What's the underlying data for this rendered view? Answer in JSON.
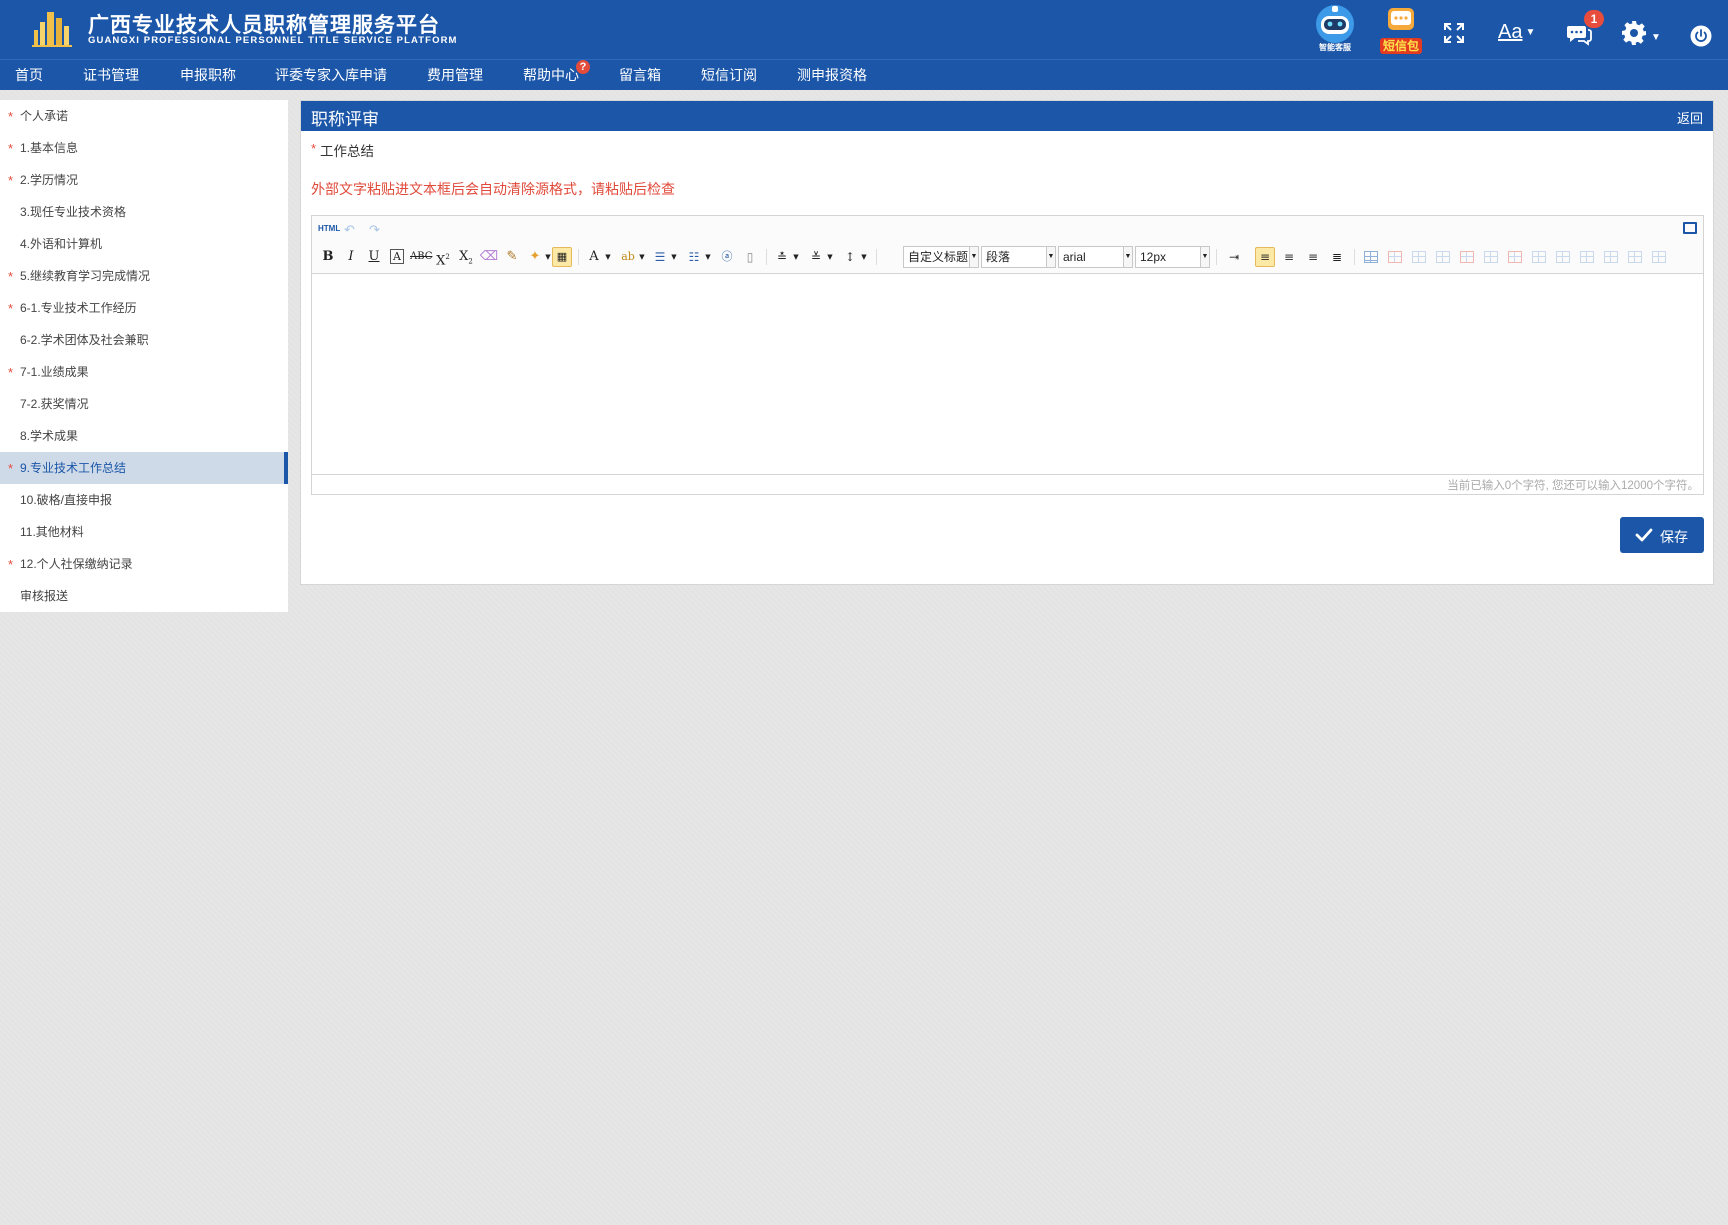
{
  "header": {
    "title_cn": "广西专业技术人员职称管理服务平台",
    "title_en": "GUANGXI PROFESSIONAL  PERSONNEL  TITLE SERVICE PLATFORM",
    "robot_caption": "智能客服",
    "sms_caption": "短信包",
    "font_label": "Aa",
    "notification_count": "1",
    "brand_color": "#1b56a8"
  },
  "nav": {
    "items": [
      {
        "label": "首页"
      },
      {
        "label": "证书管理"
      },
      {
        "label": "申报职称"
      },
      {
        "label": "评委专家入库申请"
      },
      {
        "label": "费用管理"
      },
      {
        "label": "帮助中心"
      },
      {
        "label": "留言箱"
      },
      {
        "label": "短信订阅"
      },
      {
        "label": "测申报资格"
      }
    ],
    "help_badge": "?"
  },
  "sidebar": {
    "items": [
      {
        "label": "个人承诺",
        "required": true
      },
      {
        "label": "1.基本信息",
        "required": true
      },
      {
        "label": "2.学历情况",
        "required": true
      },
      {
        "label": "3.现任专业技术资格",
        "required": false
      },
      {
        "label": "4.外语和计算机",
        "required": false
      },
      {
        "label": "5.继续教育学习完成情况",
        "required": true
      },
      {
        "label": "6-1.专业技术工作经历",
        "required": true
      },
      {
        "label": "6-2.学术团体及社会兼职",
        "required": false
      },
      {
        "label": "7-1.业绩成果",
        "required": true
      },
      {
        "label": "7-2.获奖情况",
        "required": false
      },
      {
        "label": "8.学术成果",
        "required": false
      },
      {
        "label": "9.专业技术工作总结",
        "required": true,
        "active": true
      },
      {
        "label": "10.破格/直接申报",
        "required": false
      },
      {
        "label": "11.其他材料",
        "required": false
      },
      {
        "label": "12.个人社保缴纳记录",
        "required": true
      },
      {
        "label": "审核报送",
        "required": false
      }
    ],
    "required_mark": "*"
  },
  "panel": {
    "title": "职称评审",
    "back": "返回",
    "field_label": "工作总结",
    "required_mark": "*",
    "warning": "外部文字粘贴进文本框后会自动清除源格式，请粘贴后检查",
    "save_label": "保存"
  },
  "editor": {
    "html_label": "HTML",
    "heading_select": "自定义标题",
    "paragraph_select": "段落",
    "font_select": "arial",
    "size_select": "12px",
    "counter": "当前已输入0个字符, 您还可以输入12000个字符。"
  }
}
